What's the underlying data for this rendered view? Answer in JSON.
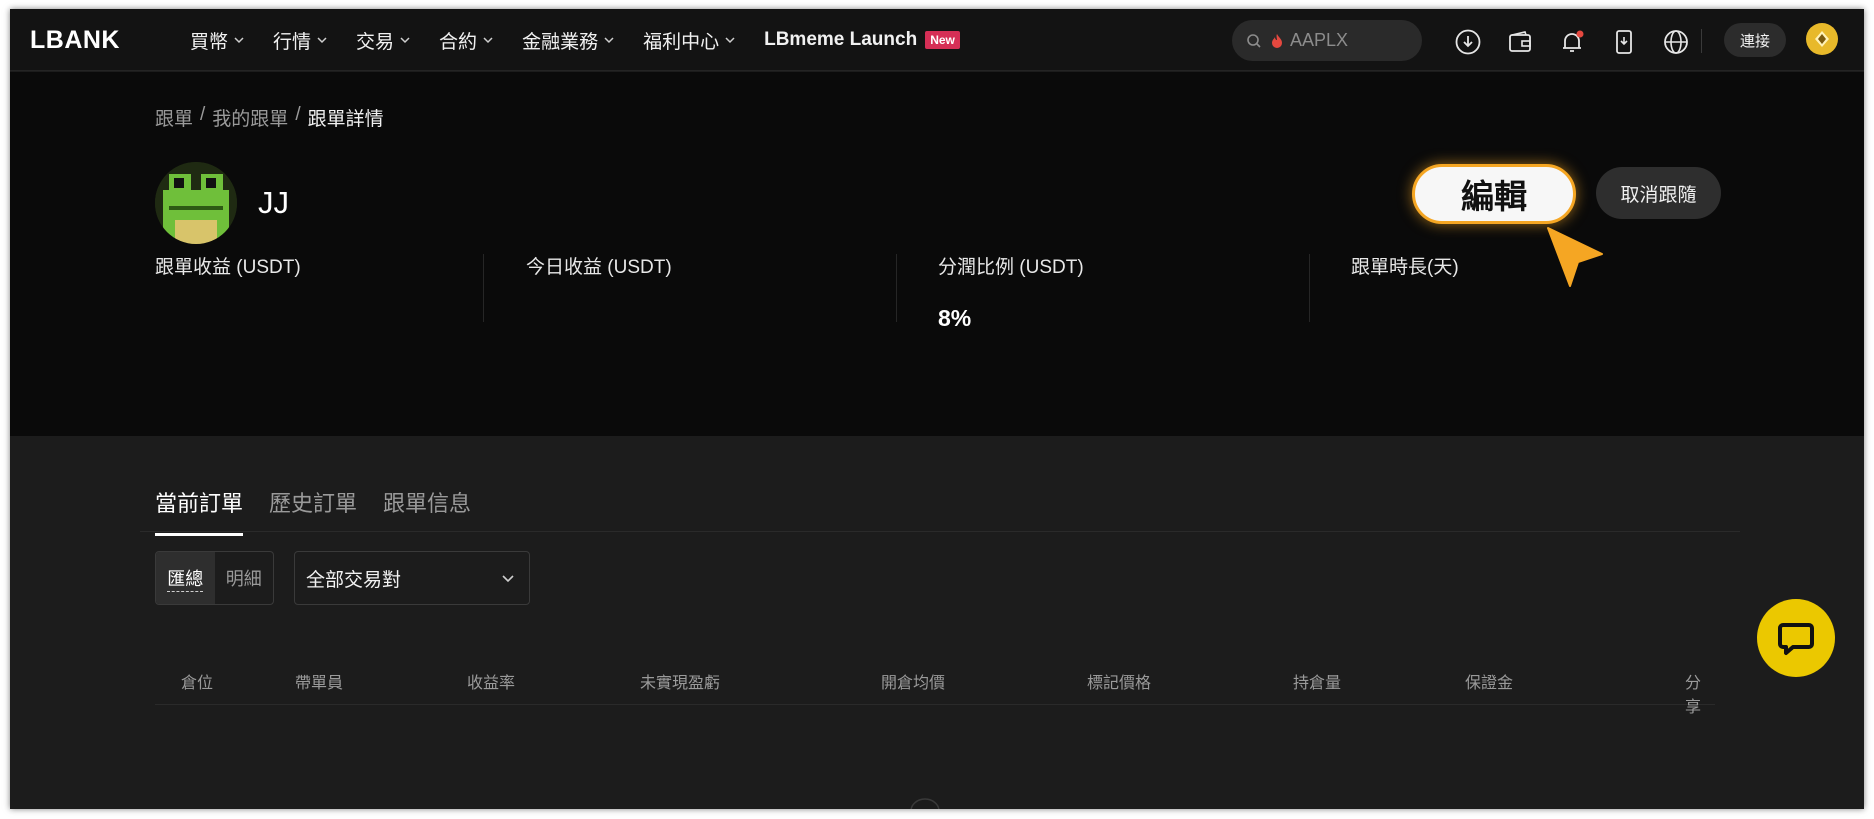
{
  "nav": {
    "logo": "LBANK",
    "menu": [
      {
        "label": "買幣",
        "dropdown": true
      },
      {
        "label": "行情",
        "dropdown": true
      },
      {
        "label": "交易",
        "dropdown": true
      },
      {
        "label": "合約",
        "dropdown": true
      },
      {
        "label": "金融業務",
        "dropdown": true
      },
      {
        "label": "福利中心",
        "dropdown": true
      },
      {
        "label": "LBmeme Launch",
        "dropdown": false,
        "badge": "New"
      }
    ],
    "search_placeholder": "AAPLX",
    "connect_label": "連接",
    "icons": [
      "download-icon",
      "wallet-icon",
      "bell-icon",
      "mobile-download-icon",
      "globe-icon"
    ]
  },
  "breadcrumb": {
    "items": [
      "跟單",
      "我的跟單",
      "跟單詳情"
    ],
    "separator": "/"
  },
  "profile": {
    "name": "JJ",
    "edit_label": "編輯",
    "unfollow_label": "取消跟隨"
  },
  "stats": [
    {
      "label": "跟單收益 (USDT)",
      "value": ""
    },
    {
      "label": "今日收益 (USDT)",
      "value": ""
    },
    {
      "label": "分潤比例 (USDT)",
      "value": "8%"
    },
    {
      "label": "跟單時長(天)",
      "value": ""
    }
  ],
  "tabs": [
    {
      "label": "當前訂單",
      "active": true
    },
    {
      "label": "歷史訂單",
      "active": false
    },
    {
      "label": "跟單信息",
      "active": false
    }
  ],
  "view_toggle": [
    {
      "label": "匯總",
      "active": true
    },
    {
      "label": "明細",
      "active": false
    }
  ],
  "pair_select": {
    "value": "全部交易對"
  },
  "table": {
    "headers": [
      "倉位",
      "帶單員",
      "收益率",
      "未實現盈虧",
      "開倉均價",
      "標記價格",
      "持倉量",
      "保證金",
      "分享"
    ]
  },
  "colors": {
    "accent": "#f5a623",
    "new_badge": "#d62f56",
    "chat": "#ebc800",
    "background": "#0a0a0a"
  }
}
